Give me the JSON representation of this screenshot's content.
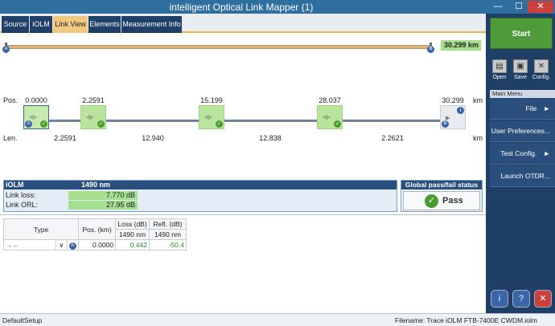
{
  "window": {
    "title": "intelligent Optical Link Mapper (1)",
    "min_glyph": "—",
    "max_glyph": "☐",
    "close_glyph": "✕"
  },
  "tabs": [
    {
      "label": "Source",
      "active": false
    },
    {
      "label": "iOLM",
      "active": false
    },
    {
      "label": "Link View",
      "active": true
    },
    {
      "label": "Elements",
      "active": false
    },
    {
      "label": "Measurement Info",
      "active": false
    }
  ],
  "overview": {
    "total_length": "30.299 km",
    "start_badge": "A",
    "end_badge": "B"
  },
  "link_view": {
    "pos_label": "Pos.",
    "len_label": "Len.",
    "unit": "km",
    "positions": [
      "0.0000",
      "2.2591",
      "15.199",
      "28.037",
      "30.299"
    ],
    "lengths": [
      "2.2591",
      "12.940",
      "12.838",
      "2.2621"
    ],
    "elem_glyph": "⟛",
    "check_glyph": "✓",
    "end_glyph": "▸",
    "a_badge": "A",
    "b_badge": "B",
    "info_badge": "i"
  },
  "results": {
    "title": "iOLM",
    "wavelength": "1490 nm",
    "link_loss_label": "Link loss:",
    "link_loss": "7.770 dB",
    "link_orl_label": "Link ORL:",
    "link_orl": "27.95 dB"
  },
  "global": {
    "title": "Global pass/fail status",
    "status": "Pass",
    "icon": "✓"
  },
  "table": {
    "headers": [
      "Type",
      "Pos. (km)",
      "Loss (dB)",
      "Refl. (dB)"
    ],
    "subheaders": [
      "1490 nm",
      "1490 nm"
    ],
    "row": {
      "type_glyph": "→←",
      "dropdown_glyph": "∨",
      "badge": "A",
      "pos": "0.0000",
      "loss": "0.442",
      "refl": "-50.4"
    }
  },
  "sidebar": {
    "start_label": "Start",
    "tools": [
      {
        "label": "Open",
        "glyph": "▤"
      },
      {
        "label": "Save",
        "glyph": "▣"
      },
      {
        "label": "Config.",
        "glyph": "✕"
      }
    ],
    "main_menu_label": "Main Menu",
    "menu": [
      {
        "label": "File",
        "arrow": "►"
      },
      {
        "label": "User Preferences...",
        "arrow": ""
      },
      {
        "label": "Test Config.",
        "arrow": "►"
      },
      {
        "label": "Launch OTDR...",
        "arrow": ""
      }
    ],
    "bottom_buttons": [
      {
        "glyph": "i"
      },
      {
        "glyph": "?"
      },
      {
        "glyph": "✕"
      }
    ]
  },
  "status": {
    "setup": "DefaultSetup",
    "filename": "Filename: Trace iOLM FTB-7400E CWDM.iolm"
  },
  "colors": {
    "accent": "#1f3f67",
    "pass": "#4a9c2e",
    "highlight": "#a6e08f",
    "tab_active": "#f2c880"
  }
}
